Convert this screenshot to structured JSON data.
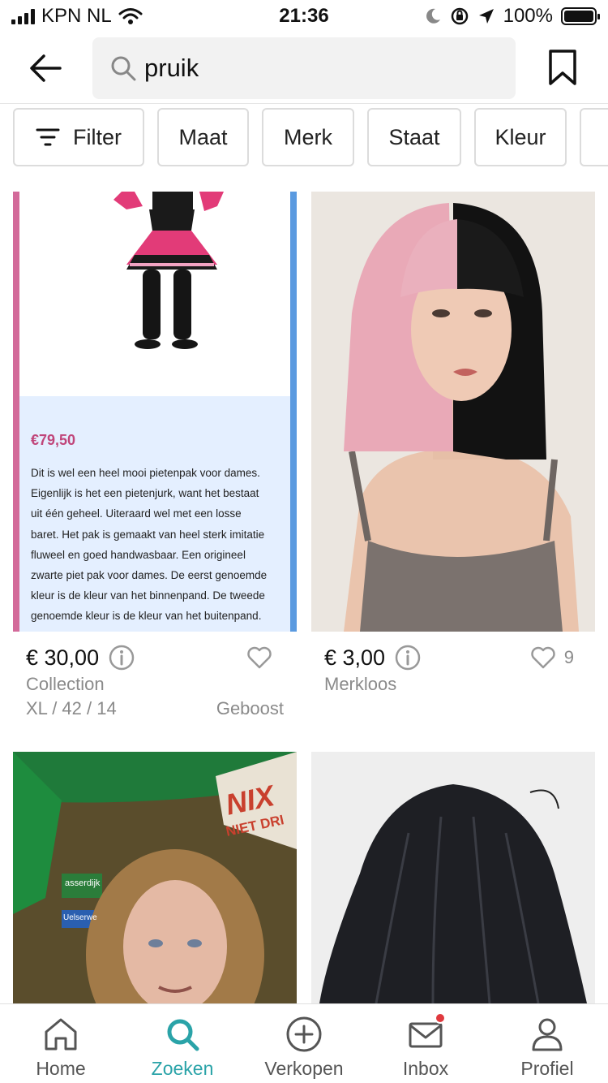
{
  "status_bar": {
    "carrier": "KPN NL",
    "time": "21:36",
    "battery": "100%"
  },
  "search": {
    "query": "pruik"
  },
  "filters": [
    {
      "label": "Filter"
    },
    {
      "label": "Maat"
    },
    {
      "label": "Merk"
    },
    {
      "label": "Staat"
    },
    {
      "label": "Kleur"
    }
  ],
  "listings": [
    {
      "price": "€ 30,00",
      "brand": "Collection",
      "size": "XL / 42 / 14",
      "boost": "Geboost",
      "likes": "",
      "image": {
        "price": "€79,50",
        "description": [
          "Dit is wel een heel mooi pietenpak voor dames.",
          "Eigenlijk is het een pietenjurk, want het bestaat",
          "uit één geheel. Uiteraard wel met een losse",
          "baret. Het pak is gemaakt van heel sterk imitatie",
          "fluweel en goed handwasbaar. Een origineel",
          "zwarte piet pak voor dames. De eerst genoemde",
          "kleur is de kleur van het binnenpand. De tweede",
          "genoemde kleur is de kleur van het buitenpand."
        ]
      }
    },
    {
      "price": "€ 3,00",
      "brand": "Merkloos",
      "likes": "9"
    },
    {
      "image": {
        "sign_top": "NIX",
        "sign_bottom": "NIET DRI",
        "street_1": "asserdijk",
        "street_2": "Uelserwe"
      }
    },
    {}
  ],
  "tabs": [
    {
      "label": "Home"
    },
    {
      "label": "Zoeken"
    },
    {
      "label": "Verkopen"
    },
    {
      "label": "Inbox"
    },
    {
      "label": "Profiel"
    }
  ],
  "colors": {
    "accent": "#2aa3a8",
    "notification": "#e0393e"
  }
}
